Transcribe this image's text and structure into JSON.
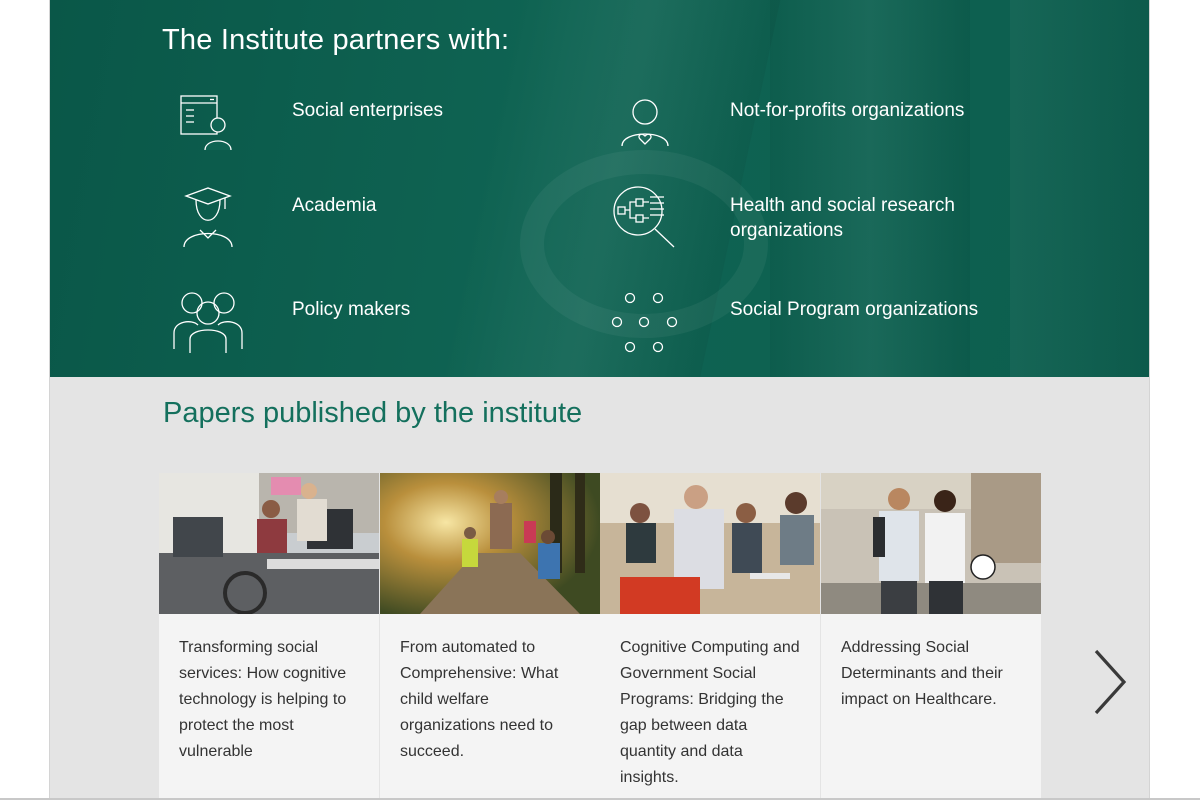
{
  "hero": {
    "title": "The Institute partners with:",
    "partners": [
      {
        "label": "Social enterprises",
        "icon": "browser-person-icon"
      },
      {
        "label": "Not-for-profits organizations",
        "icon": "person-heart-icon"
      },
      {
        "label": "Academia",
        "icon": "graduate-icon"
      },
      {
        "label": "Health and social research organizations",
        "icon": "research-magnifier-icon"
      },
      {
        "label": "Policy makers",
        "icon": "group-people-icon"
      },
      {
        "label": "Social Program organizations",
        "icon": "dot-network-icon"
      }
    ]
  },
  "papers": {
    "title": "Papers published by the institute",
    "cards": [
      {
        "text": "Transforming social services: How cognitive technology is helping to protect the most vulnerable",
        "image": "office-workers-photo"
      },
      {
        "text": "From automated to Comprehensive: What child welfare organizations need to succeed.",
        "image": "family-forest-walk-photo"
      },
      {
        "text": "Cognitive Computing and Government Social Programs: Bridging the gap between data quantity and data insights.",
        "image": "group-discussion-photo"
      },
      {
        "text": "Addressing Social Determinants and their impact on Healthcare.",
        "image": "friends-soccer-photo"
      }
    ],
    "next_icon": "chevron-right-icon"
  },
  "colors": {
    "hero_bg": "#0f6453",
    "accent_green": "#14705d",
    "papers_bg": "#e4e4e4",
    "card_bg": "#f4f4f4"
  }
}
